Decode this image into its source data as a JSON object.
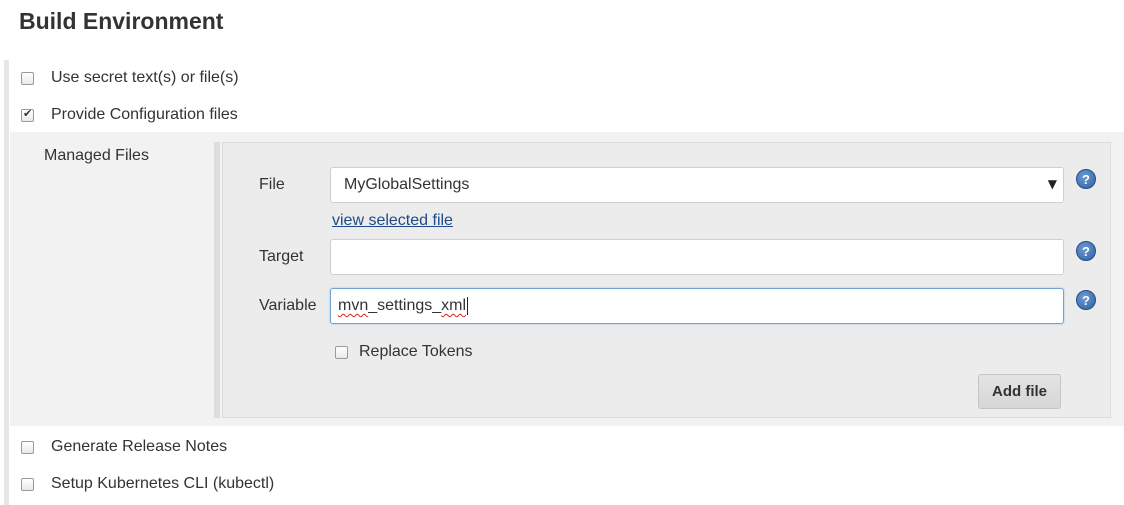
{
  "section": {
    "title": "Build Environment"
  },
  "options": [
    {
      "label": "Use secret text(s) or file(s)",
      "checked": false
    },
    {
      "label": "Provide Configuration files",
      "checked": true
    },
    {
      "label": "Generate Release Notes",
      "checked": false
    },
    {
      "label": "Setup Kubernetes CLI (kubectl)",
      "checked": false
    }
  ],
  "managed": {
    "label": "Managed Files",
    "file": {
      "label": "File",
      "selected": "MyGlobalSettings"
    },
    "view_link": "view selected file",
    "target": {
      "label": "Target",
      "value": ""
    },
    "variable": {
      "label": "Variable",
      "value": "mvn_settings_xml",
      "value_parts": [
        "mvn",
        "_settings_",
        "xml"
      ]
    },
    "replace_tokens": {
      "label": "Replace Tokens",
      "checked": false
    },
    "add_button": "Add file",
    "help_glyph": "?"
  },
  "icons": {
    "help": "help-icon",
    "dropdown": "chevron-down-icon"
  },
  "colors": {
    "link": "#204a87",
    "help": "#2f5fa0",
    "panel": "#f2f2f2"
  }
}
